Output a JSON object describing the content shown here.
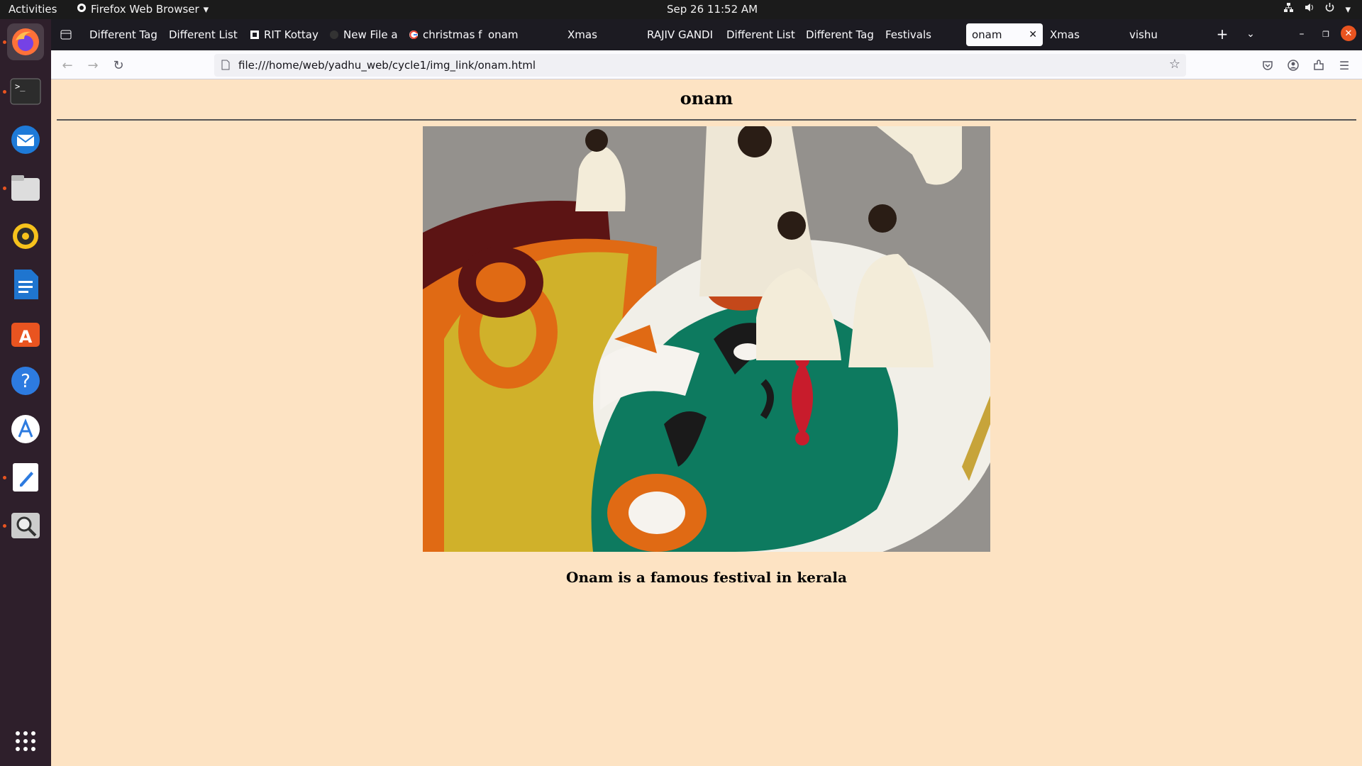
{
  "system_bar": {
    "activities": "Activities",
    "app_name": "Firefox Web Browser",
    "clock": "Sep 26  11:52 AM"
  },
  "dock": {
    "items": [
      "firefox-icon",
      "terminal-icon",
      "thunderbird-icon",
      "files-icon",
      "rhythmbox-icon",
      "writer-icon",
      "software-center-icon",
      "help-icon",
      "app-store-icon",
      "text-editor-icon",
      "search-tool-icon",
      "app-grid-icon"
    ]
  },
  "browser": {
    "tabs": [
      {
        "label": "Different Tag"
      },
      {
        "label": "Different List"
      },
      {
        "label": "RIT Kottay"
      },
      {
        "label": "New File a"
      },
      {
        "label": "christmas f"
      },
      {
        "label": "onam"
      },
      {
        "label": "Xmas"
      },
      {
        "label": "RAJIV GANDI"
      },
      {
        "label": "Different List"
      },
      {
        "label": "Different Tag"
      },
      {
        "label": "Festivals"
      },
      {
        "label": "onam"
      },
      {
        "label": "Xmas"
      },
      {
        "label": "vishu"
      }
    ],
    "url": "file:///home/web/yadhu_web/cycle1/img_link/onam.html"
  },
  "page": {
    "heading": "onam",
    "caption": "Onam is a famous festival in kerala"
  },
  "colors": {
    "page_background": "#fde3c3",
    "dock_background": "#2e1f2b",
    "accent": "#e95420"
  }
}
